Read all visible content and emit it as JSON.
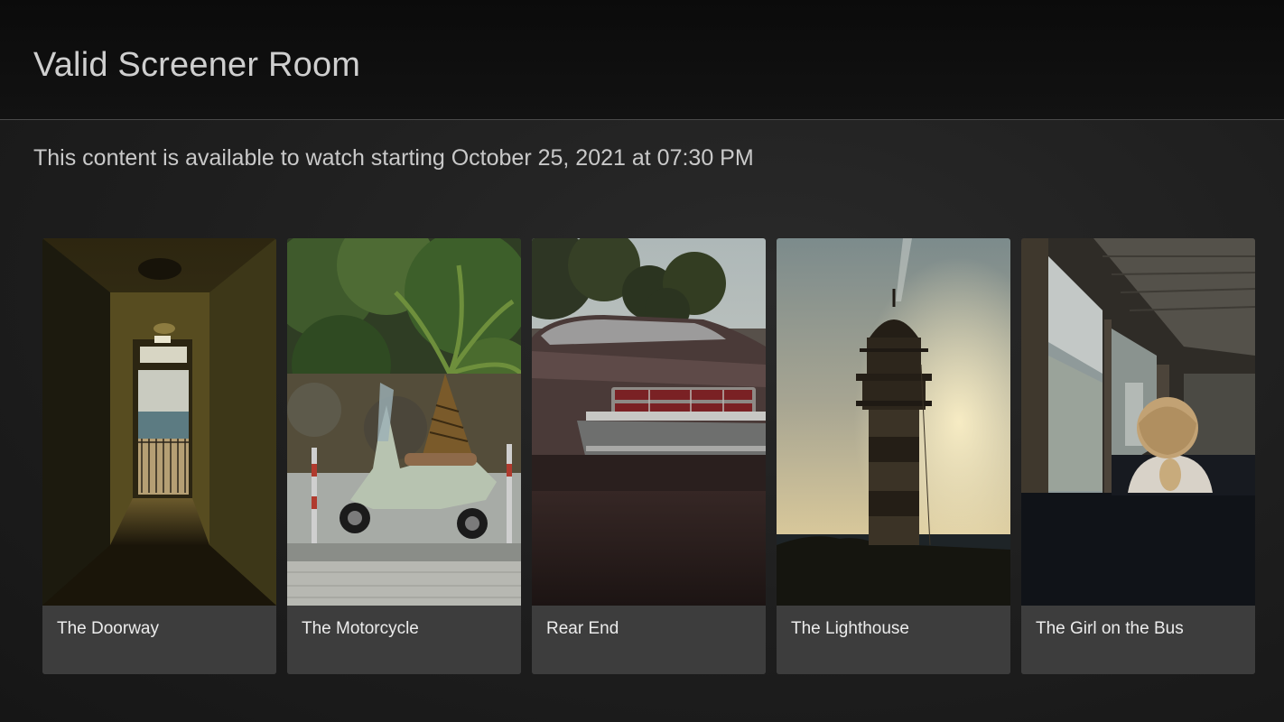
{
  "header": {
    "title": "Valid Screener Room"
  },
  "availability": {
    "text": "This content is available to watch starting October 25, 2021 at 07:30 PM"
  },
  "cards": [
    {
      "title": "The Doorway",
      "image": "hallway-doorway-photo"
    },
    {
      "title": "The Motorcycle",
      "image": "scooter-palm-photo"
    },
    {
      "title": "Rear End",
      "image": "vintage-car-rear-photo"
    },
    {
      "title": "The Lighthouse",
      "image": "lighthouse-sunset-photo"
    },
    {
      "title": "The Girl on the Bus",
      "image": "girl-on-bus-photo"
    }
  ]
}
